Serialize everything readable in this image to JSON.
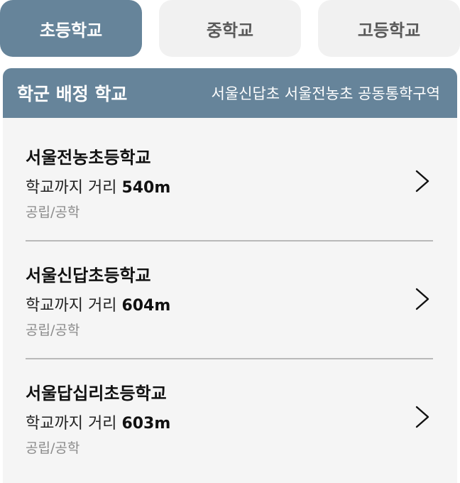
{
  "tabs": [
    {
      "label": "초등학교",
      "active": true
    },
    {
      "label": "중학교",
      "active": false
    },
    {
      "label": "고등학교",
      "active": false
    }
  ],
  "panel": {
    "title": "학군 배정 학교",
    "subtitle": "서울신답초 서울전농초 공동통학구역"
  },
  "schools": [
    {
      "name": "서울전농초등학교",
      "distance_label": "학교까지 거리",
      "distance": "540m",
      "type": "공립/공학"
    },
    {
      "name": "서울신답초등학교",
      "distance_label": "학교까지 거리",
      "distance": "604m",
      "type": "공립/공학"
    },
    {
      "name": "서울답십리초등학교",
      "distance_label": "학교까지 거리",
      "distance": "603m",
      "type": "공립/공학"
    }
  ],
  "colors": {
    "accent": "#66849a",
    "tab_inactive_bg": "#f1f1f1",
    "panel_bg": "#f5f5f5"
  },
  "icons": {
    "row_arrow": "chevron-right-icon"
  }
}
